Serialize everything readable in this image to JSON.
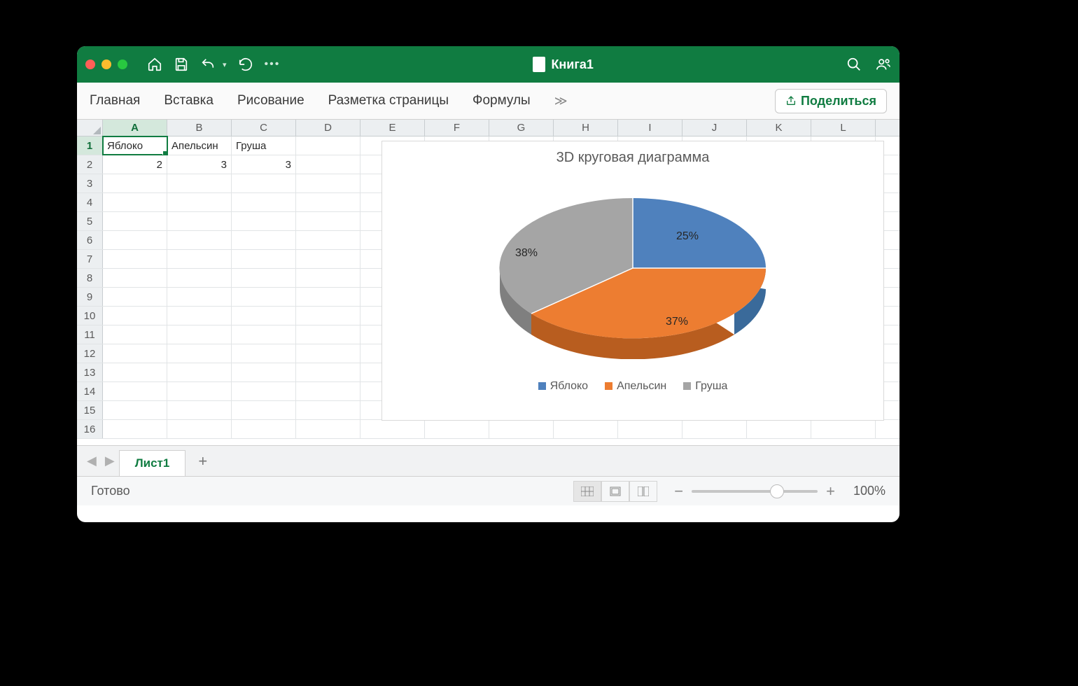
{
  "window": {
    "title": "Книга1"
  },
  "ribbon": {
    "tabs": [
      "Главная",
      "Вставка",
      "Рисование",
      "Разметка страницы",
      "Формулы"
    ],
    "share": "Поделиться"
  },
  "columns": [
    "A",
    "B",
    "C",
    "D",
    "E",
    "F",
    "G",
    "H",
    "I",
    "J",
    "K",
    "L"
  ],
  "row_numbers": [
    1,
    2,
    3,
    4,
    5,
    6,
    7,
    8,
    9,
    10,
    11,
    12,
    13,
    14,
    15,
    16
  ],
  "active_cell": "A1",
  "cells": {
    "r1": {
      "A": "Яблоко",
      "B": "Апельсин",
      "C": "Груша"
    },
    "r2": {
      "A": "2",
      "B": "3",
      "C": "3"
    }
  },
  "chart_data": {
    "type": "pie",
    "title": "3D круговая диаграмма",
    "categories": [
      "Яблоко",
      "Апельсин",
      "Груша"
    ],
    "values": [
      2,
      3,
      3
    ],
    "labels": [
      "25%",
      "37%",
      "38%"
    ],
    "colors": {
      "Яблоко": "#4F81BD",
      "Апельсин": "#ED7D31",
      "Груша": "#A5A5A5"
    },
    "legend_position": "bottom"
  },
  "sheet": {
    "name": "Лист1"
  },
  "status": {
    "ready": "Готово",
    "zoom": "100%"
  }
}
